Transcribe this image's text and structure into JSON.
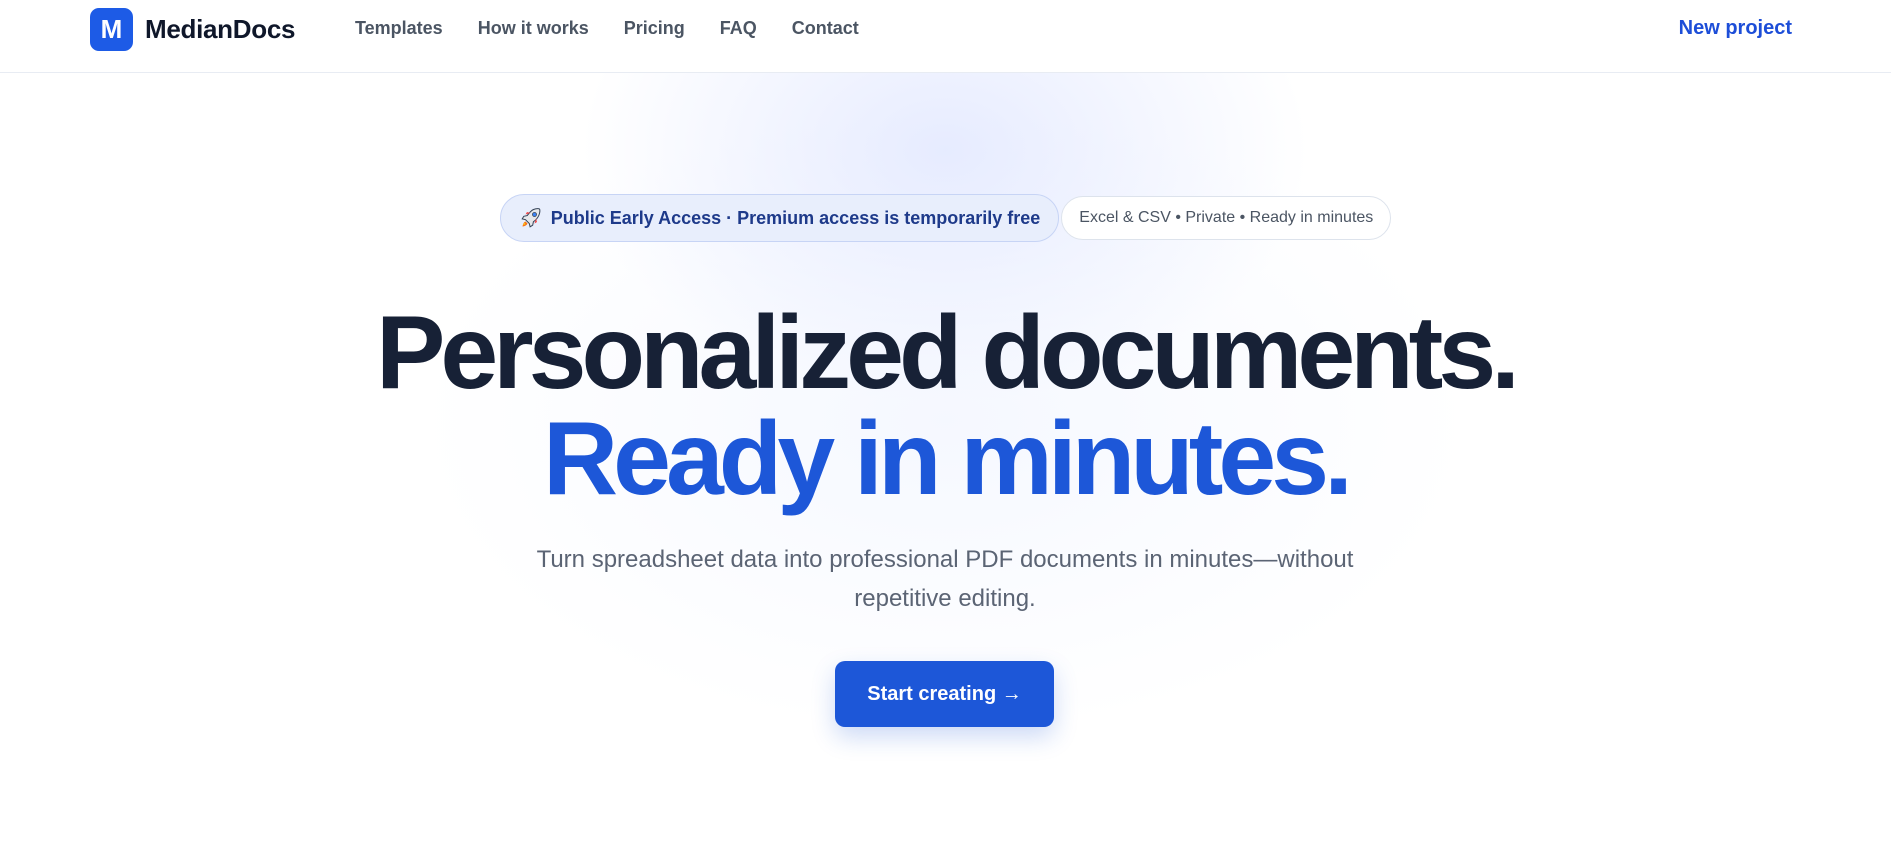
{
  "header": {
    "logo_letter": "M",
    "brand": "MedianDocs",
    "nav": [
      {
        "label": "Templates"
      },
      {
        "label": "How it works"
      },
      {
        "label": "Pricing"
      },
      {
        "label": "FAQ"
      },
      {
        "label": "Contact"
      }
    ],
    "new_project_label": "New project"
  },
  "badges": {
    "primary_icon": "rocket-icon",
    "primary": "Public Early Access · Premium access is temporarily free",
    "secondary": "Excel & CSV • Private • Ready in minutes"
  },
  "hero": {
    "title_line_1": "Personalized documents.",
    "title_line_2": "Ready in minutes.",
    "subtitle": "Turn spreadsheet data into professional PDF documents in minutes—without repetitive editing.",
    "cta_label": "Start creating →"
  },
  "colors": {
    "brand": "#1d5be6",
    "accent_text": "#1d57d8",
    "heading": "#172136",
    "muted": "#5b6474"
  }
}
